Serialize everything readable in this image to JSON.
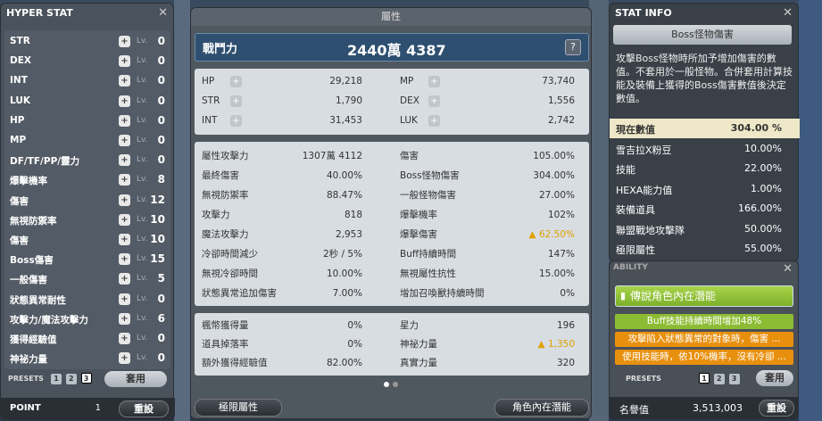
{
  "hyper_stat": {
    "title": "HYPER STAT",
    "lv_label": "Lv.",
    "rows": [
      {
        "name": "STR",
        "lv": "0"
      },
      {
        "name": "DEX",
        "lv": "0"
      },
      {
        "name": "INT",
        "lv": "0"
      },
      {
        "name": "LUK",
        "lv": "0"
      },
      {
        "name": "HP",
        "lv": "0"
      },
      {
        "name": "MP",
        "lv": "0"
      },
      {
        "name": "DF/TF/PP/靈力",
        "lv": "0"
      },
      {
        "name": "爆擊機率",
        "lv": "8"
      },
      {
        "name": "傷害",
        "lv": "12"
      },
      {
        "name": "無視防禦率",
        "lv": "10"
      },
      {
        "name": "傷害",
        "lv": "10"
      },
      {
        "name": "Boss傷害",
        "lv": "15"
      },
      {
        "name": "一般傷害",
        "lv": "5"
      },
      {
        "name": "狀態異常耐性",
        "lv": "0"
      },
      {
        "name": "攻擊力/魔法攻擊力",
        "lv": "6"
      },
      {
        "name": "獲得經驗值",
        "lv": "0"
      },
      {
        "name": "神祕力量",
        "lv": "0"
      }
    ],
    "presets_label": "PRESETS",
    "presets": [
      "1",
      "2",
      "3"
    ],
    "apply_label": "套用",
    "point_label": "POINT",
    "point_value": "1",
    "reset_label": "重設"
  },
  "attributes": {
    "title": "屬性",
    "cp_label": "戰鬥力",
    "cp_value": "2440萬 4387",
    "help": "?",
    "base": {
      "hp_l": "HP",
      "hp": "29,218",
      "mp_l": "MP",
      "mp": "73,740",
      "str_l": "STR",
      "str": "1,790",
      "dex_l": "DEX",
      "dex": "1,556",
      "int_l": "INT",
      "int": "31,453",
      "luk_l": "LUK",
      "luk": "2,742"
    },
    "detail": [
      {
        "k": "屬性攻擊力",
        "v": "1307萬 4112"
      },
      {
        "k": "傷害",
        "v": "105.00%"
      },
      {
        "k": "最終傷害",
        "v": "40.00%"
      },
      {
        "k": "Boss怪物傷害",
        "v": "304.00%"
      },
      {
        "k": "無視防禦率",
        "v": "88.47%"
      },
      {
        "k": "一般怪物傷害",
        "v": "27.00%"
      },
      {
        "k": "攻擊力",
        "v": "818"
      },
      {
        "k": "爆擊機率",
        "v": "102%"
      },
      {
        "k": "魔法攻擊力",
        "v": "2,953"
      },
      {
        "k": "爆擊傷害",
        "v": "62.50%"
      },
      {
        "k": "冷卻時間減少",
        "v": "2秒 / 5%"
      },
      {
        "k": "Buff持續時間",
        "v": "147%"
      },
      {
        "k": "無視冷卻時間",
        "v": "10.00%"
      },
      {
        "k": "無視屬性抗性",
        "v": "15.00%"
      },
      {
        "k": "狀態異常追加傷害",
        "v": "7.00%"
      },
      {
        "k": "增加召喚獸持續時間",
        "v": "0%"
      }
    ],
    "extra": [
      {
        "k": "楓幣獲得量",
        "v": "0%"
      },
      {
        "k": "星力",
        "v": "196"
      },
      {
        "k": "道具掉落率",
        "v": "0%"
      },
      {
        "k": "神祕力量",
        "v": "1,350"
      },
      {
        "k": "額外獲得經驗值",
        "v": "82.00%"
      },
      {
        "k": "真實力量",
        "v": "320"
      }
    ],
    "btn_hyper": "極限屬性",
    "btn_ability": "角色內在潛能"
  },
  "stat_info": {
    "title": "STAT INFO",
    "subtitle": "Boss怪物傷害",
    "desc": "攻擊Boss怪物時所加予增加傷害的數值。不套用於一般怪物。合併套用計算技能及裝備上獲得的Boss傷害數值後決定數值。",
    "rows": [
      {
        "k": "現在數值",
        "v": "304.00 %"
      },
      {
        "k": "雪吉拉X粉豆",
        "v": "10.00%"
      },
      {
        "k": "技能",
        "v": "22.00%"
      },
      {
        "k": "HEXA能力值",
        "v": "1.00%"
      },
      {
        "k": "裝備道具",
        "v": "166.00%"
      },
      {
        "k": "聯盟戰地攻擊隊",
        "v": "50.00%"
      },
      {
        "k": "極限屬性",
        "v": "55.00%"
      }
    ]
  },
  "ability": {
    "title": "ABILITY",
    "grade": "傳說角色內在潛能",
    "lines": [
      "Buff技能持續時間增加48%",
      "攻擊陷入狀態異常的對象時，傷害 ...",
      "使用技能時，依10%機率，沒有冷卻 ..."
    ],
    "presets_label": "PRESETS",
    "presets": [
      "1",
      "2",
      "3"
    ],
    "apply_label": "套用",
    "fame_label": "名譽值",
    "fame_value": "3,513,003",
    "reset_label": "重設"
  }
}
